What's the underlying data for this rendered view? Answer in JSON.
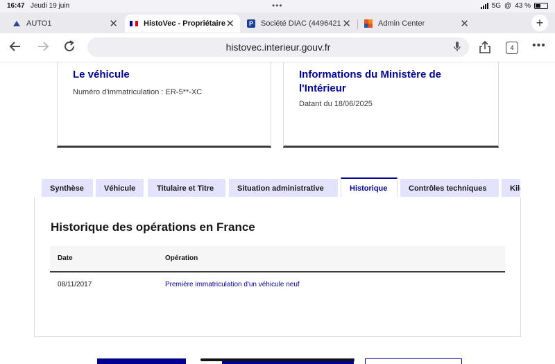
{
  "status_bar": {
    "time": "16:47",
    "date": "Jeudi 19 juin",
    "network": "5G",
    "battery": "43 %"
  },
  "browser_tabs": [
    {
      "title": "AUTO1",
      "favicon": "auto1-logo-icon",
      "active": false
    },
    {
      "title": "HistoVec - Propriétaire",
      "favicon": "french-flag-icon",
      "active": true
    },
    {
      "title": "Société DIAC (4496421",
      "favicon": "p-logo-icon",
      "active": false
    },
    {
      "title": "Admin Center",
      "favicon": "admin-center-logo-icon",
      "active": false
    }
  ],
  "address_bar": {
    "url": "histovec.interieur.gouv.fr",
    "tab_count": "4"
  },
  "cards": {
    "vehicle": {
      "title": "Le véhicule",
      "text": "Numéro d'immatriculation : ER-5**-XC"
    },
    "ministry": {
      "title_line1": "Informations du Ministère de",
      "title_line2": "l'Intérieur",
      "text": "Datant du 18/06/2025"
    }
  },
  "page_tabs": [
    {
      "label": "Synthèse"
    },
    {
      "label": "Véhicule"
    },
    {
      "label": "Titulaire et Titre"
    },
    {
      "label": "Situation administrative"
    },
    {
      "label": "Historique"
    },
    {
      "label": "Contrôles techniques"
    },
    {
      "label": "Kilométrage"
    }
  ],
  "history": {
    "heading": "Historique des opérations en France",
    "columns": [
      "Date",
      "Opération"
    ],
    "rows": [
      {
        "date": "08/11/2017",
        "operation": "Première immatriculation d'un véhicule neuf"
      }
    ]
  },
  "colors": {
    "accent": "#000091",
    "tab_background": "#e3e3fd",
    "text": "#161616"
  }
}
